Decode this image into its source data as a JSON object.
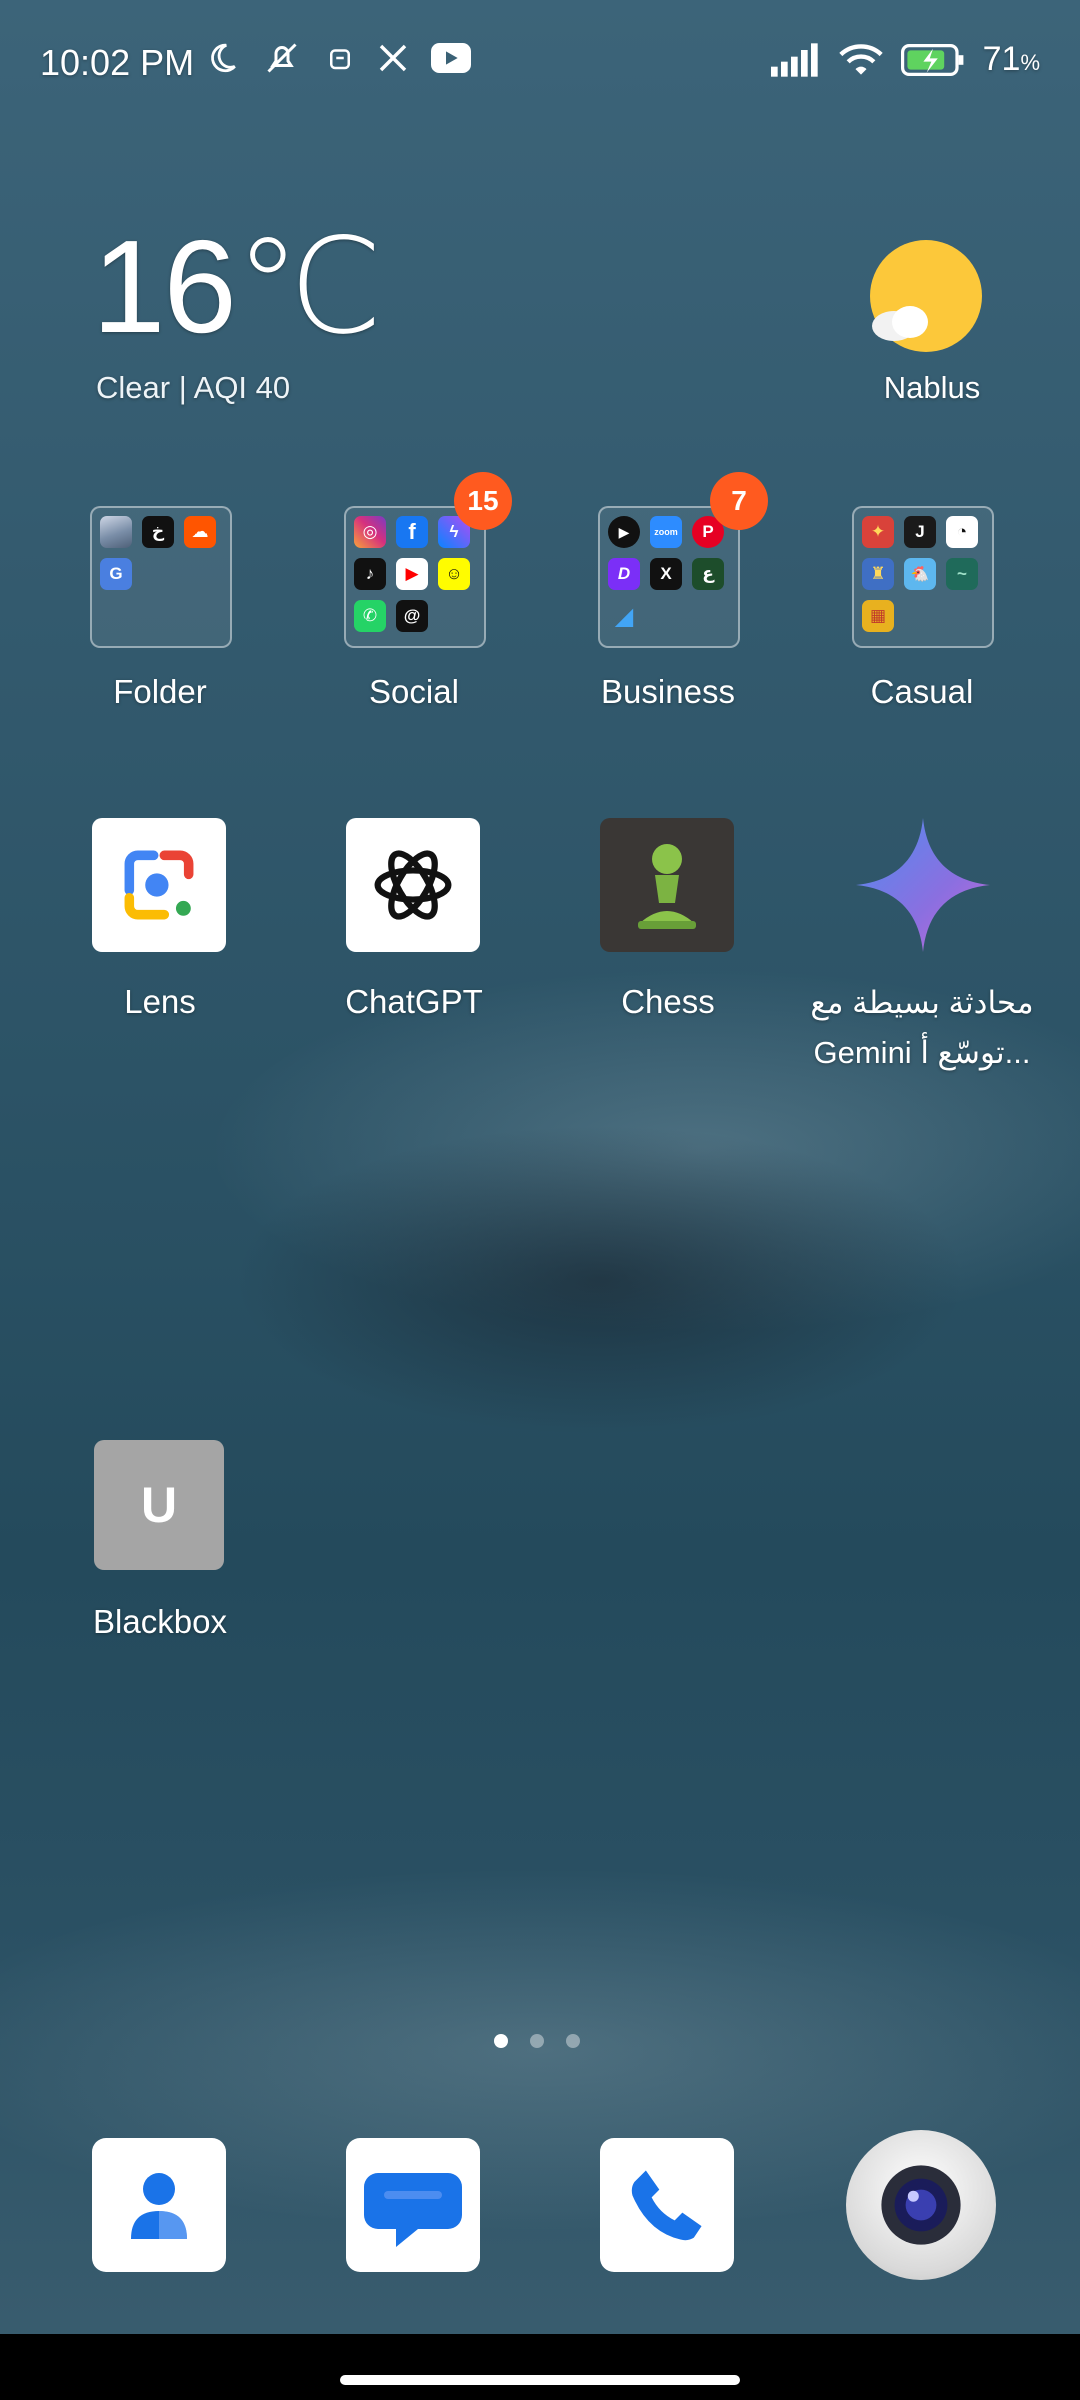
{
  "status_bar": {
    "time": "10:02 PM",
    "battery_percent": "71",
    "battery_unit": "%",
    "icons_left": [
      "moon-icon",
      "silent-icon",
      "vpn-robot-icon",
      "x-app-icon",
      "youtube-icon"
    ],
    "icons_right": [
      "signal-icon",
      "wifi-icon",
      "battery-charging-icon"
    ]
  },
  "weather": {
    "temperature": "16℃",
    "condition": "Clear | AQI 40",
    "city": "Nablus",
    "icon": "sun-cloud-icon"
  },
  "folders": [
    {
      "label": "Folder",
      "badge": "",
      "apps": [
        {
          "icon": "gallery-icon",
          "bg": "#7a8ea8",
          "glyph": ""
        },
        {
          "icon": "arabic-app-icon",
          "bg": "#111111",
          "glyph": "خ"
        },
        {
          "icon": "soundcloud-icon",
          "bg": "#ff5500",
          "glyph": "☁"
        },
        {
          "icon": "google-translate-icon",
          "bg": "#4a7fe0",
          "glyph": "G"
        }
      ]
    },
    {
      "label": "Social",
      "badge": "15",
      "apps": [
        {
          "icon": "instagram-icon",
          "bg": "#d6307e",
          "glyph": "◎"
        },
        {
          "icon": "facebook-icon",
          "bg": "#1877f2",
          "glyph": "f"
        },
        {
          "icon": "messenger-icon",
          "bg": "#7d5cf2",
          "glyph": "ϟ"
        },
        {
          "icon": "tiktok-icon",
          "bg": "#111111",
          "glyph": "♪"
        },
        {
          "icon": "youtube-icon",
          "bg": "#ff0000",
          "glyph": "▶"
        },
        {
          "icon": "snapchat-icon",
          "bg": "#fffc00",
          "glyph": "☺"
        },
        {
          "icon": "whatsapp-icon",
          "bg": "#25d366",
          "glyph": "✆"
        },
        {
          "icon": "threads-icon",
          "bg": "#111111",
          "glyph": "@"
        }
      ]
    },
    {
      "label": "Business",
      "badge": "7",
      "apps": [
        {
          "icon": "play-icon",
          "bg": "#ffffff",
          "glyph": "▶"
        },
        {
          "icon": "zoom-icon",
          "bg": "#2d8cff",
          "glyph": "zoom"
        },
        {
          "icon": "pinterest-icon",
          "bg": "#e60023",
          "glyph": "P"
        },
        {
          "icon": "d-app-icon",
          "bg": "#7b2ff7",
          "glyph": "D"
        },
        {
          "icon": "x-icon",
          "bg": "#111111",
          "glyph": "X"
        },
        {
          "icon": "arabic-news-icon",
          "bg": "#1d4d2b",
          "glyph": "ع"
        },
        {
          "icon": "flutter-icon",
          "bg": "transparent",
          "glyph": "◢"
        }
      ]
    },
    {
      "label": "Casual",
      "badge": "",
      "apps": [
        {
          "icon": "game-candy-icon",
          "bg": "#d9423a",
          "glyph": "✦"
        },
        {
          "icon": "game-j-icon",
          "bg": "#1a1a1a",
          "glyph": "J"
        },
        {
          "icon": "game-speed-icon",
          "bg": "#ffffff",
          "glyph": "◔"
        },
        {
          "icon": "game-castle-icon",
          "bg": "#3f6fc4",
          "glyph": "♜"
        },
        {
          "icon": "game-chicken-icon",
          "bg": "#5db7ef",
          "glyph": "🐔"
        },
        {
          "icon": "game-green-icon",
          "bg": "#1f6a5a",
          "glyph": "~"
        },
        {
          "icon": "game-blocks-icon",
          "bg": "#e8b11f",
          "glyph": "▦"
        }
      ]
    }
  ],
  "apps": [
    {
      "label": "Lens"
    },
    {
      "label": "ChatGPT"
    },
    {
      "label": "Chess"
    },
    {
      "label": "محادثة بسيطة مع Gemini توسّع أ..."
    },
    {
      "label": "Blackbox",
      "letter": "U"
    }
  ],
  "pager": {
    "pages": 3,
    "current": 1
  },
  "dock": [
    {
      "name": "contacts-icon"
    },
    {
      "name": "messages-icon"
    },
    {
      "name": "phone-icon"
    },
    {
      "name": "camera-icon"
    }
  ]
}
